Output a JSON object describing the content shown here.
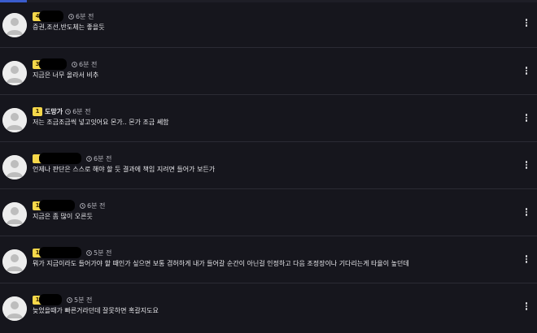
{
  "theme": {
    "background": "#16161d",
    "divider": "#2b2b34",
    "badge": "#f6d84a",
    "text": "#e8e8ec",
    "muted": "#b8b8c0"
  },
  "page_load_progress": 0.05,
  "icons": {
    "avatar": "default-user-avatar-icon",
    "time": "clock-icon",
    "more": "more-vertical-icon"
  },
  "comments": [
    {
      "level": "4",
      "nickname": "",
      "time": "6분 전",
      "text": "증권,조선,반도체는 좋을듯"
    },
    {
      "level": "3",
      "nickname": "",
      "time": "6분 전",
      "text": "지금은 너무 올라서 비추"
    },
    {
      "level": "1",
      "nickname": "도망가",
      "time": "6분 전",
      "text": "저는 조금조금씩 넣고잇어요 몬가.. 몬가 조금 쎄함"
    },
    {
      "level": "",
      "nickname": "",
      "time": "6분 전",
      "text": "언제나 판단은 스스로 해야 할 듯 결과에 책임 지려면 들어가 보든가"
    },
    {
      "level": "1",
      "nickname": "",
      "time": "6분 전",
      "text": "지금은 좀 많이 오른듯"
    },
    {
      "level": "1",
      "nickname": "",
      "time": "5분 전",
      "text": "뭐가 지금이라도 들어가야 할 때인가 싶으면 보통 겸허하게 내가 들어갈 순간이 아닌걸 인정하고 다음 조정장이나 기다리는게 타율이 높던데"
    },
    {
      "level": "1",
      "nickname": "",
      "time": "5분 전",
      "text": "늦었을때가 빠른거라던데 잘못하면 혹갈지도요"
    }
  ]
}
